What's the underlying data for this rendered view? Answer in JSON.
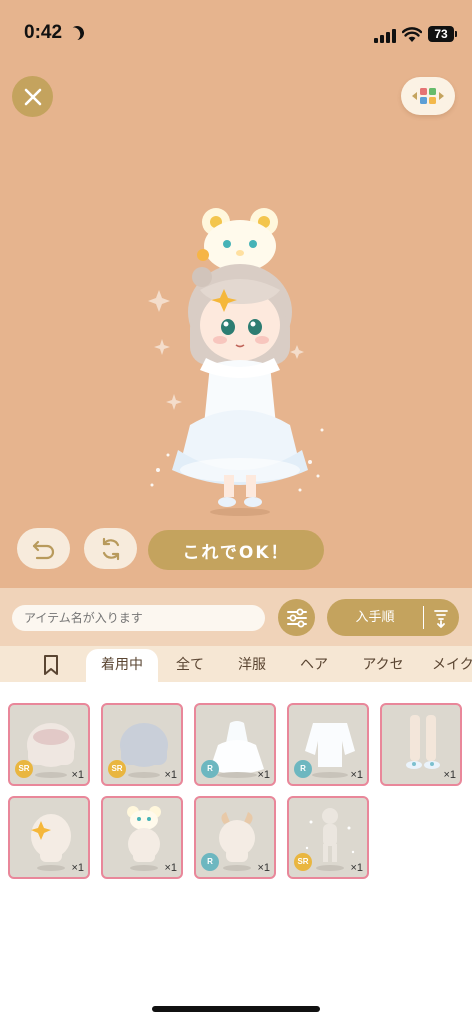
{
  "status_bar": {
    "time": "0:42",
    "battery": "73"
  },
  "preview": {
    "confirm_label": "これでOK！",
    "icons": {
      "close": "close-icon",
      "palette": "palette-icon",
      "undo": "undo-icon",
      "randomize": "refresh-icon"
    }
  },
  "toolbar": {
    "search_placeholder": "アイテム名が入ります",
    "sort_label": "入手順",
    "icons": {
      "filter": "sliders-icon",
      "sort_order": "sort-order-icon"
    }
  },
  "tabs": [
    {
      "label": "着用中",
      "active": true
    },
    {
      "label": "全て",
      "active": false
    },
    {
      "label": "洋服",
      "active": false
    },
    {
      "label": "ヘア",
      "active": false
    },
    {
      "label": "アクセ",
      "active": false
    },
    {
      "label": "メイク",
      "active": false
    }
  ],
  "items": [
    {
      "kind": "hair-bob",
      "rarity": "SR",
      "count": "×1"
    },
    {
      "kind": "hair-dark",
      "rarity": "SR",
      "count": "×1"
    },
    {
      "kind": "dress",
      "rarity": "R",
      "count": "×1"
    },
    {
      "kind": "jacket",
      "rarity": "R",
      "count": "×1"
    },
    {
      "kind": "socks",
      "rarity": "",
      "count": "×1"
    },
    {
      "kind": "hair-clip",
      "rarity": "",
      "count": "×1"
    },
    {
      "kind": "bear-hat",
      "rarity": "",
      "count": "×1"
    },
    {
      "kind": "horns",
      "rarity": "R",
      "count": "×1"
    },
    {
      "kind": "sparkle-effect",
      "rarity": "SR",
      "count": "×1"
    }
  ],
  "colors": {
    "stage_bg": "#e6b48e",
    "gold": "#c4a35e",
    "card_border": "#e9879a",
    "sr_badge": "#e9b640",
    "r_badge": "#6db7c0"
  }
}
